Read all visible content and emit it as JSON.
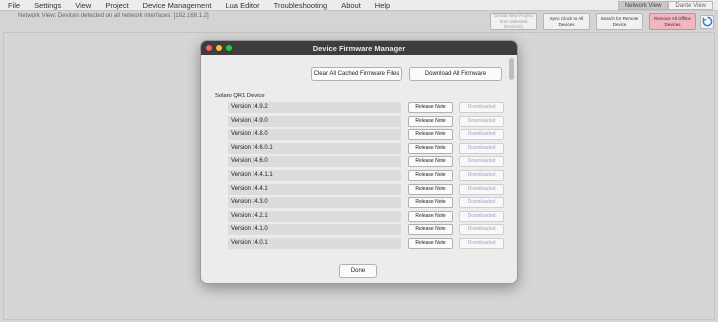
{
  "menu": [
    "File",
    "Settings",
    "View",
    "Project",
    "Device Management",
    "Lua Editor",
    "Troubleshooting",
    "About",
    "Help"
  ],
  "view_toggle": {
    "network": "Network View",
    "dante": "Dante View"
  },
  "status_text": "Network View: Devices detected on all network interfaces:  [192.168.1.2]",
  "toolbar": {
    "create_project": "Create New Project from Selected Device(s)",
    "sync_clock": "Sync Clock to All Devices",
    "search_remote": "Search for Remote Device",
    "remove_offline": "Remove All Offline Devices"
  },
  "dialog": {
    "title": "Device Firmware Manager",
    "clear_cache": "Clear All Cached Firmware Files",
    "download_all": "Download All Firmware",
    "device_name": "Solaro QR1 Device",
    "release_label": "Release Note",
    "downloaded_label": "Downloaded",
    "done": "Done",
    "versions": [
      "Version :4.9.2",
      "Version :4.9.0",
      "Version :4.8.0",
      "Version :4.6.0.1",
      "Version :4.6.0",
      "Version :4.4.1.1",
      "Version :4.4.1",
      "Version :4.3.0",
      "Version :4.2.1",
      "Version :4.1.0",
      "Version :4.0.1"
    ]
  },
  "colors": {
    "accent_danger": "#f2b6c0",
    "title_bar": "#3d3d3d",
    "downloaded_text": "#9aa2c7"
  }
}
